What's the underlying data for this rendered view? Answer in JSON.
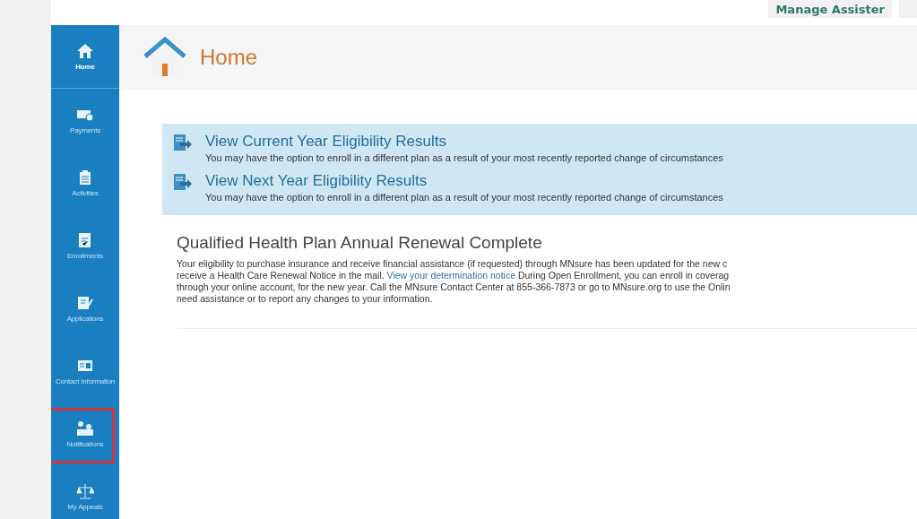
{
  "top_bar": {
    "button": "Manage Assister"
  },
  "sidebar": {
    "items": [
      {
        "label": "Home",
        "selected": true,
        "highlighted": false
      },
      {
        "label": "Payments",
        "selected": false,
        "highlighted": false
      },
      {
        "label": "Activities",
        "selected": false,
        "highlighted": false
      },
      {
        "label": "Enrollments",
        "selected": false,
        "highlighted": false
      },
      {
        "label": "Applications",
        "selected": false,
        "highlighted": false
      },
      {
        "label": "Contact Information",
        "selected": false,
        "highlighted": false
      },
      {
        "label": "Notifications",
        "selected": false,
        "highlighted": true
      },
      {
        "label": "My Appeals",
        "selected": false,
        "highlighted": false
      }
    ]
  },
  "page": {
    "title": "Home"
  },
  "eligibility_links": [
    {
      "title": "View Current Year Eligibility Results",
      "description": "You may have the option to enroll in a different plan as a result of your most recently reported change of circumstances"
    },
    {
      "title": "View Next Year Eligibility Results",
      "description": "You may have the option to enroll in a different plan as a result of your most recently reported change of circumstances"
    }
  ],
  "notice": {
    "heading": "Qualified Health Plan Annual Renewal Complete",
    "lines": [
      {
        "text": "Your eligibility to purchase insurance and receive financial assistance (if requested) through MNsure has been updated for the new c"
      },
      {
        "text": "receive a Health Care Renewal Notice in the mail. ",
        "link": "View your determination notice",
        "after": " During Open Enrollment, you can enroll in coverag"
      },
      {
        "text": "through your online account, for the new year. Call the MNsure Contact Center at 855-366-7873 or go to MNsure.org to use the Onlin"
      },
      {
        "text": "need assistance or to report any changes to your information."
      }
    ]
  }
}
